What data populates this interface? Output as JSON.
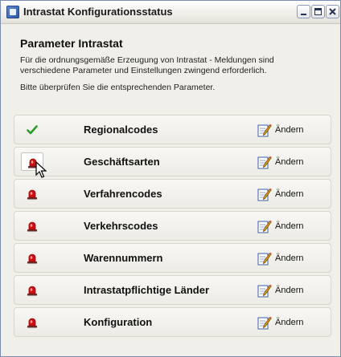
{
  "window": {
    "title": "Intrastat Konfigurationsstatus",
    "icon": "app-icon",
    "controls": [
      "minimize-icon",
      "maximize-icon",
      "close-icon"
    ]
  },
  "content": {
    "heading": "Parameter Intrastat",
    "description": "Für die ordnungsgemäße Erzeugung von Intrastat - Meldungen sind verschiedene Parameter und Einstellungen zwingend erforderlich.",
    "instruction": "Bitte überprüfen Sie die entsprechenden Parameter."
  },
  "colors": {
    "ok": "#2e9a2e",
    "error": "#d01010",
    "title_bar": "#e9e7df",
    "panel": "#f0efe9"
  },
  "rows": [
    {
      "label": "Regionalcodes",
      "status": "ok",
      "status_icon": "green-check-icon",
      "action_label": "Ändern"
    },
    {
      "label": "Geschäftsarten",
      "status": "error",
      "status_icon": "red-alarm-light-icon",
      "action_label": "Ändern"
    },
    {
      "label": "Verfahrencodes",
      "status": "error",
      "status_icon": "red-alarm-light-icon",
      "action_label": "Ändern"
    },
    {
      "label": "Verkehrscodes",
      "status": "error",
      "status_icon": "red-alarm-light-icon",
      "action_label": "Ändern"
    },
    {
      "label": "Warennummern",
      "status": "error",
      "status_icon": "red-alarm-light-icon",
      "action_label": "Ändern"
    },
    {
      "label": "Intrastatpflichtige Länder",
      "status": "error",
      "status_icon": "red-alarm-light-icon",
      "action_label": "Ändern"
    },
    {
      "label": "Konfiguration",
      "status": "error",
      "status_icon": "red-alarm-light-icon",
      "action_label": "Ändern"
    }
  ]
}
